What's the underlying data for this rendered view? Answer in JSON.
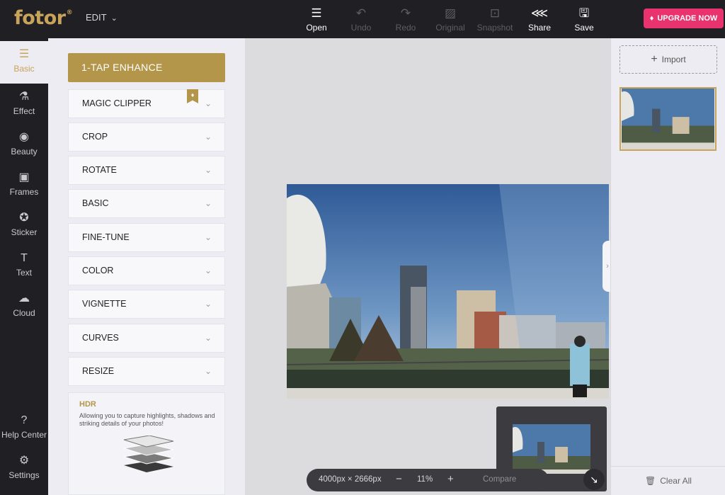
{
  "app": {
    "logo": "fotor",
    "logo_mark": "®",
    "edit_menu": "EDIT"
  },
  "toolbar": {
    "open": "Open",
    "undo": "Undo",
    "redo": "Redo",
    "original": "Original",
    "snapshot": "Snapshot",
    "share": "Share",
    "save": "Save",
    "upgrade": "UPGRADE NOW"
  },
  "nav": [
    {
      "label": "Basic",
      "icon": "sliders-icon",
      "glyph": "☰"
    },
    {
      "label": "Effect",
      "icon": "flask-icon",
      "glyph": "⚗"
    },
    {
      "label": "Beauty",
      "icon": "eye-icon",
      "glyph": "◉"
    },
    {
      "label": "Frames",
      "icon": "frame-icon",
      "glyph": "▣"
    },
    {
      "label": "Sticker",
      "icon": "sticker-icon",
      "glyph": "✪"
    },
    {
      "label": "Text",
      "icon": "text-icon",
      "glyph": "T"
    },
    {
      "label": "Cloud",
      "icon": "cloud-upload-icon",
      "glyph": "☁"
    },
    {
      "label": "Help Center",
      "icon": "help-icon",
      "glyph": "?"
    },
    {
      "label": "Settings",
      "icon": "gear-icon",
      "glyph": "⚙"
    }
  ],
  "panel": {
    "enhance": "1-TAP ENHANCE",
    "sections": [
      "MAGIC CLIPPER",
      "CROP",
      "ROTATE",
      "BASIC",
      "FINE-TUNE",
      "COLOR",
      "VIGNETTE",
      "CURVES",
      "RESIZE"
    ],
    "hdr_title": "HDR",
    "hdr_desc": "Allowing you to capture highlights, shadows and striking details of your photos!"
  },
  "canvas": {
    "dimensions": "4000px × 2666px",
    "zoom": "11%",
    "compare": "Compare"
  },
  "right": {
    "import": "Import",
    "clear_all": "Clear All"
  },
  "colors": {
    "accent": "#c8a45a",
    "brand_gold": "#b39649",
    "upgrade": "#e8336f",
    "dark": "#1f1f24"
  }
}
